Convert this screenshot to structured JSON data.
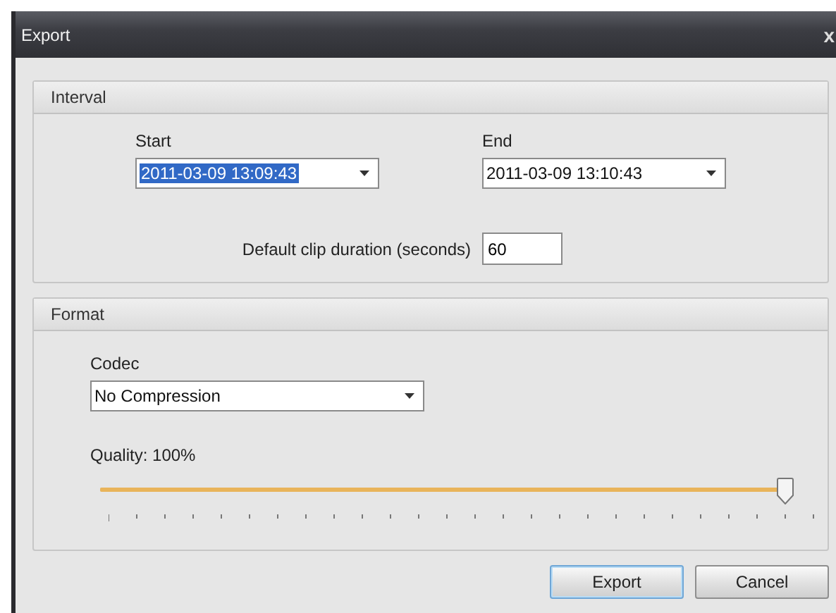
{
  "window": {
    "title": "Export",
    "close": "x"
  },
  "interval": {
    "title": "Interval",
    "start": {
      "label": "Start",
      "value": "2011-03-09 13:09:43",
      "selected": true
    },
    "end": {
      "label": "End",
      "value": "2011-03-09 13:10:43",
      "selected": false
    },
    "duration": {
      "label": "Default clip duration (seconds)",
      "value": "60"
    }
  },
  "format": {
    "title": "Format",
    "codec": {
      "label": "Codec",
      "value": "No Compression"
    },
    "quality": {
      "label": "Quality: 100%",
      "level": 1
    }
  },
  "buttons": [
    {
      "label": "Export",
      "default": true
    },
    {
      "label": "Cancel",
      "default": false
    }
  ]
}
